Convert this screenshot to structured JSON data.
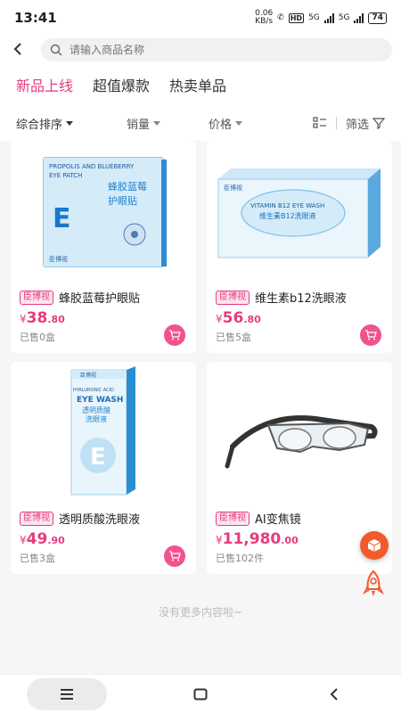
{
  "status": {
    "time": "13:41",
    "speed_top": "0.06",
    "speed_unit": "KB/s",
    "hd": "HD",
    "net1": "5G",
    "net2": "5G",
    "battery": "74"
  },
  "header": {
    "search_placeholder": "请输入商品名称"
  },
  "tabs": [
    {
      "label": "新品上线"
    },
    {
      "label": "超值爆款"
    },
    {
      "label": "热卖单品"
    }
  ],
  "sort": {
    "default": "综合排序",
    "sales": "销量",
    "price": "价格",
    "filter": "筛选"
  },
  "products": [
    {
      "brand": "臣博视",
      "name": "蜂胶蓝莓护眼贴",
      "cur": "¥",
      "price_int": "38",
      "price_dec": ".80",
      "sold": "已售0盒",
      "box_title1": "PROPOLIS AND BLUEBERRY",
      "box_title2": "EYE PATCH",
      "box_cn": "蜂胶蓝莓",
      "box_cn2": "护眼贴",
      "box_brand": "臣博视",
      "box_letter": "E"
    },
    {
      "brand": "臣博视",
      "name": "维生素b12洗眼液",
      "cur": "¥",
      "price_int": "56",
      "price_dec": ".80",
      "sold": "已售5盒",
      "box_title1": "VITAMIN B12 EYE WASH",
      "box_cn": "维生素B12洗眼液",
      "box_brand": "臣博视"
    },
    {
      "brand": "臣博视",
      "name": "透明质酸洗眼液",
      "cur": "¥",
      "price_int": "49",
      "price_dec": ".90",
      "sold": "已售3盒",
      "box_title1": "HYALURONIC ACID",
      "box_title2": "EYE WASH",
      "box_cn": "透明质酸",
      "box_cn2": "洗眼液",
      "box_brand": "臣博视",
      "box_letter": "E"
    },
    {
      "brand": "臣博视",
      "name": "AI变焦镜",
      "cur": "¥",
      "price_int": "11,980",
      "price_dec": ".00",
      "sold": "已售102件"
    }
  ],
  "footer": {
    "no_more": "没有更多内容啦~"
  },
  "colors": {
    "accent": "#e63b7f"
  }
}
